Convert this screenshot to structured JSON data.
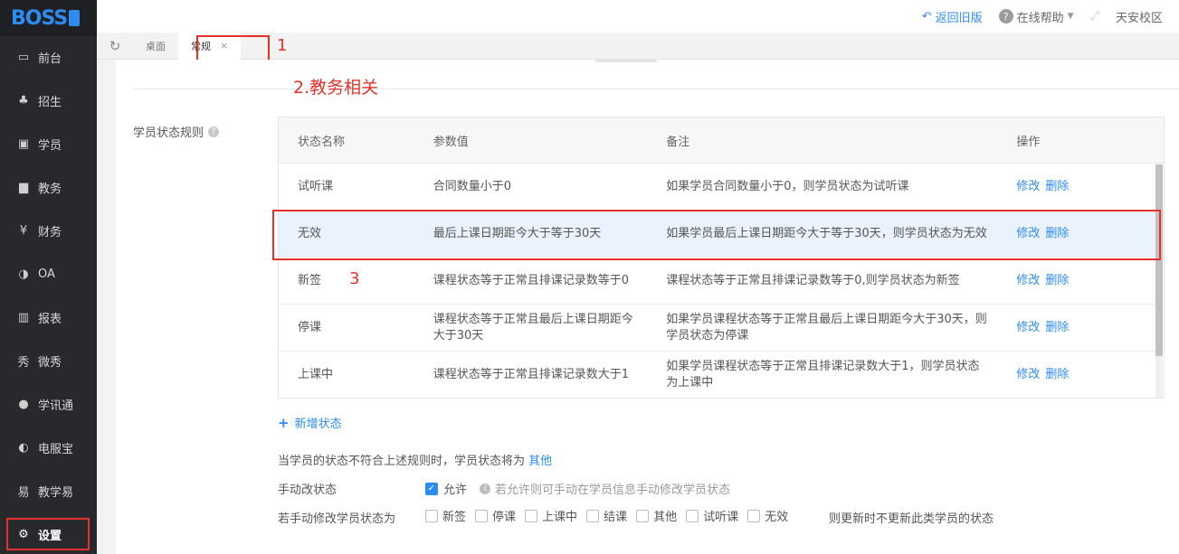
{
  "app": {
    "logo": "BOSS"
  },
  "topbar": {
    "back_old": "返回旧版",
    "help": "在线帮助",
    "campus": "天安校区"
  },
  "tabs": [
    {
      "label": "桌面"
    },
    {
      "label": "常规",
      "close": "×"
    }
  ],
  "sidebar": {
    "items": [
      {
        "label": "前台"
      },
      {
        "label": "招生"
      },
      {
        "label": "学员"
      },
      {
        "label": "教务"
      },
      {
        "label": "财务"
      },
      {
        "label": "OA"
      },
      {
        "label": "报表"
      },
      {
        "label": "微秀"
      },
      {
        "label": "学讯通"
      },
      {
        "label": "电服宝"
      },
      {
        "label": "教学易"
      },
      {
        "label": "设置"
      }
    ]
  },
  "annotations": {
    "n1": "1",
    "title": "2.教务相关",
    "n3": "3"
  },
  "rule": {
    "label": "学员状态规则"
  },
  "table": {
    "headers": [
      "状态名称",
      "参数值",
      "备注",
      "操作"
    ],
    "rows": [
      {
        "name": "试听课",
        "param": "合同数量小于0",
        "note": "如果学员合同数量小于0，则学员状态为试听课"
      },
      {
        "name": "无效",
        "param": "最后上课日期距今大于等于30天",
        "note": "如果学员最后上课日期距今大于等于30天，则学员状态为无效"
      },
      {
        "name": "新签",
        "param": "课程状态等于正常且排课记录数等于0",
        "note": "课程状态等于正常且排课记录数等于0,则学员状态为新签"
      },
      {
        "name": "停课",
        "param": "课程状态等于正常且最后上课日期距今大于30天",
        "note": "如果学员课程状态等于正常且最后上课日期距今大于30天，则学员状态为停课"
      },
      {
        "name": "上课中",
        "param": "课程状态等于正常且排课记录数大于1",
        "note": "如果学员课程状态等于正常且排课记录数大于1，则学员状态为上课中"
      }
    ],
    "edit": "修改",
    "delete": "删除"
  },
  "add_state": "新增状态",
  "otherwise": {
    "text": "当学员的状态不符合上述规则时，学员状态将为",
    "value": "其他"
  },
  "manual": {
    "label": "手动改状态",
    "allow": "允许",
    "hint": "若允许则可手动在学员信息手动修改学员状态"
  },
  "manual2": {
    "label": "若手动修改学员状态为",
    "options": [
      "新签",
      "停课",
      "上课中",
      "结课",
      "其他",
      "试听课",
      "无效"
    ],
    "tail": "则更新时不更新此类学员的状态"
  }
}
